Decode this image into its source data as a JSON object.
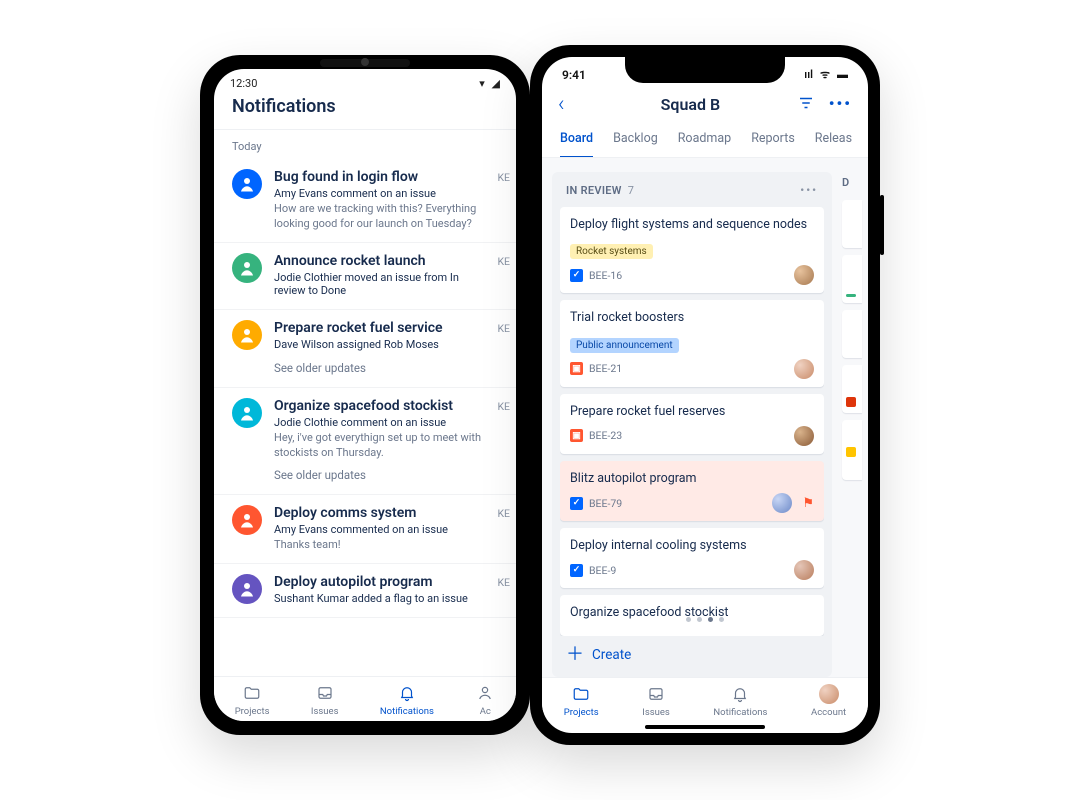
{
  "left": {
    "status_time": "12:30",
    "page_title": "Notifications",
    "section_label": "Today",
    "see_older": "See older updates",
    "key_label": "KE",
    "notifications": [
      {
        "color": "#0065ff",
        "title": "Bug found in login flow",
        "sub": "Amy Evans comment on an issue",
        "snippet": "How are we tracking with this? Everything looking good for our launch on Tuesday?"
      },
      {
        "color": "#36b37e",
        "title": "Announce rocket launch",
        "sub": "Jodie Clothier moved an issue from In review to Done",
        "snippet": ""
      },
      {
        "color": "#ffab00",
        "title": "Prepare rocket fuel service",
        "sub": "Dave Wilson assigned Rob Moses",
        "snippet": "",
        "see_older": true
      },
      {
        "color": "#00b8d9",
        "title": "Organize spacefood stockist",
        "sub": "Jodie Clothie comment on an issue",
        "snippet": "Hey, i've got everythign set up to meet with stockists on Thursday.",
        "see_older": true
      },
      {
        "color": "#ff5630",
        "title": "Deploy comms system",
        "sub": "Amy Evans commented on an issue",
        "snippet": "Thanks team!"
      },
      {
        "color": "#6554c0",
        "title": "Deploy autopilot program",
        "sub": "Sushant Kumar added a flag to an issue",
        "snippet": ""
      }
    ],
    "nav": {
      "projects": "Projects",
      "issues": "Issues",
      "notifications": "Notifications",
      "account": "Ac"
    }
  },
  "right": {
    "status_time": "9:41",
    "title": "Squad B",
    "tabs": [
      "Board",
      "Backlog",
      "Roadmap",
      "Reports",
      "Releas"
    ],
    "column": {
      "name": "IN REVIEW",
      "count": "7"
    },
    "cards": [
      {
        "title": "Deploy flight systems and sequence nodes",
        "label": {
          "text": "Rocket systems",
          "cls": "yellow"
        },
        "icon": "task",
        "key": "BEE-16",
        "assignee": "a"
      },
      {
        "title": "Trial rocket boosters",
        "label": {
          "text": "Public announcement",
          "cls": "blue"
        },
        "icon": "bug",
        "key": "BEE-21",
        "assignee": "b"
      },
      {
        "title": "Prepare rocket fuel reserves",
        "icon": "bug",
        "key": "BEE-23",
        "assignee": "c"
      },
      {
        "title": "Blitz autopilot program",
        "icon": "task",
        "key": "BEE-79",
        "assignee": "d",
        "flag": true
      },
      {
        "title": "Deploy internal cooling systems",
        "icon": "task",
        "key": "BEE-9",
        "assignee": "e"
      },
      {
        "title": "Organize spacefood stockist",
        "nokey": true
      }
    ],
    "create": "Create",
    "nav": {
      "projects": "Projects",
      "issues": "Issues",
      "notifications": "Notifications",
      "account": "Account"
    }
  }
}
